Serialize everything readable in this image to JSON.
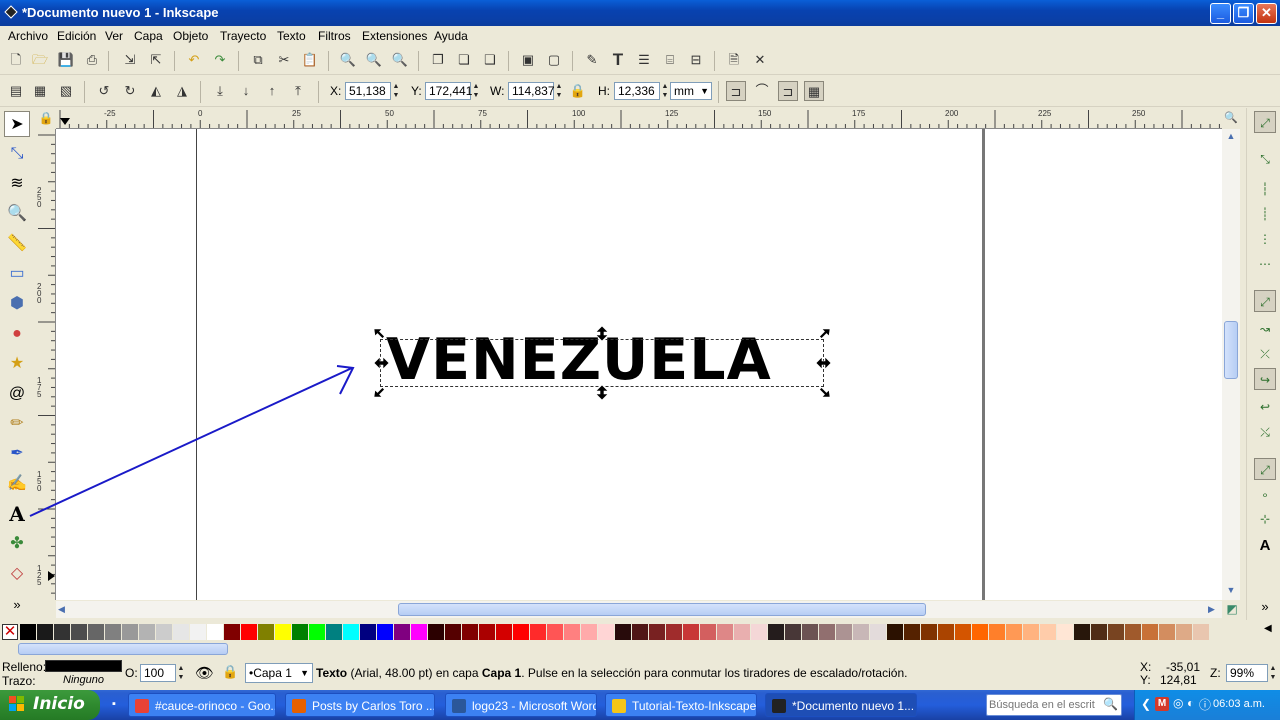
{
  "window": {
    "title": "*Documento nuevo 1 - Inkscape",
    "min": "_",
    "max": "❐",
    "close": "✕"
  },
  "menu": [
    "Archivo",
    "Edición",
    "Ver",
    "Capa",
    "Objeto",
    "Trayecto",
    "Texto",
    "Filtros",
    "Extensiones",
    "Ayuda"
  ],
  "selector_toolbar": {
    "x_label": "X:",
    "x_value": "51,138",
    "y_label": "Y:",
    "y_value": "172,441",
    "w_label": "W:",
    "w_value": "114,837",
    "h_label": "H:",
    "h_value": "12,336",
    "unit": "mm"
  },
  "ruler": {
    "h_labels": [
      "-25",
      "0",
      "25",
      "50",
      "75",
      "100",
      "125",
      "150",
      "175",
      "200",
      "225",
      "250"
    ],
    "v_labels": [
      "2 5 0",
      "2 2 5",
      "2 0 0",
      "1 7 5",
      "1 5 0",
      "1 2 5"
    ]
  },
  "canvas": {
    "text": "VENEZUELA"
  },
  "palette": {
    "colors": [
      "#000000",
      "#1a1a1a",
      "#333333",
      "#4d4d4d",
      "#666666",
      "#808080",
      "#999999",
      "#b3b3b3",
      "#cccccc",
      "#e6e6e6",
      "#f2f2f2",
      "#ffffff",
      "#800000",
      "#ff0000",
      "#808000",
      "#ffff00",
      "#008000",
      "#00ff00",
      "#008080",
      "#00ffff",
      "#000080",
      "#0000ff",
      "#800080",
      "#ff00ff",
      "#2b0000",
      "#550000",
      "#800000",
      "#aa0000",
      "#d40000",
      "#ff0000",
      "#ff2a2a",
      "#ff5555",
      "#ff8080",
      "#ffaaaa",
      "#ffd5d5",
      "#280b0b",
      "#501616",
      "#782121",
      "#a02c2c",
      "#c83737",
      "#d35f5f",
      "#de8787",
      "#e9afaf",
      "#f4d7d7",
      "#241c1c",
      "#483737",
      "#6c5353",
      "#916f6f",
      "#ac9393",
      "#c8b7b7",
      "#e3dbdb",
      "#2b1100",
      "#552200",
      "#803300",
      "#aa4400",
      "#d45500",
      "#ff6600",
      "#ff7f2a",
      "#ff9955",
      "#ffb380",
      "#ffccaa",
      "#ffe6d5",
      "#28170b",
      "#502d16",
      "#784421",
      "#a05a2c",
      "#c87137",
      "#d38d5f",
      "#deaa87",
      "#e9c6af"
    ]
  },
  "status": {
    "fill_label": "Relleno:",
    "fill_color": "#000000",
    "stroke_label": "Trazo:",
    "stroke_value": "Ninguno",
    "opacity_label": "O:",
    "opacity_value": "100",
    "layer": "•Capa 1",
    "message_bold": "Texto",
    "message_rest": " (Arial, 48.00 pt) en capa ",
    "message_layer": "Capa 1",
    "message_end": ". Pulse en la selección para conmutar los tiradores de escalado/rotación.",
    "cursor_x_label": "X:",
    "cursor_x": "-35,01",
    "cursor_y_label": "Y:",
    "cursor_y": "124,81",
    "zoom_label": "Z:",
    "zoom": "99%"
  },
  "taskbar": {
    "start": "Inicio",
    "tasks": [
      {
        "label": "#cauce-orinoco - Goo...",
        "color": "#e94235"
      },
      {
        "label": "Posts by Carlos Toro ...",
        "color": "#e66000"
      },
      {
        "label": "logo23 - Microsoft Word",
        "color": "#2b579a"
      },
      {
        "label": "Tutorial-Texto-Inkscape",
        "color": "#f5c518"
      },
      {
        "label": "*Documento nuevo 1...",
        "color": "#222222"
      }
    ],
    "search_placeholder": "Búsqueda en el escrit",
    "clock": "06:03 a.m."
  }
}
